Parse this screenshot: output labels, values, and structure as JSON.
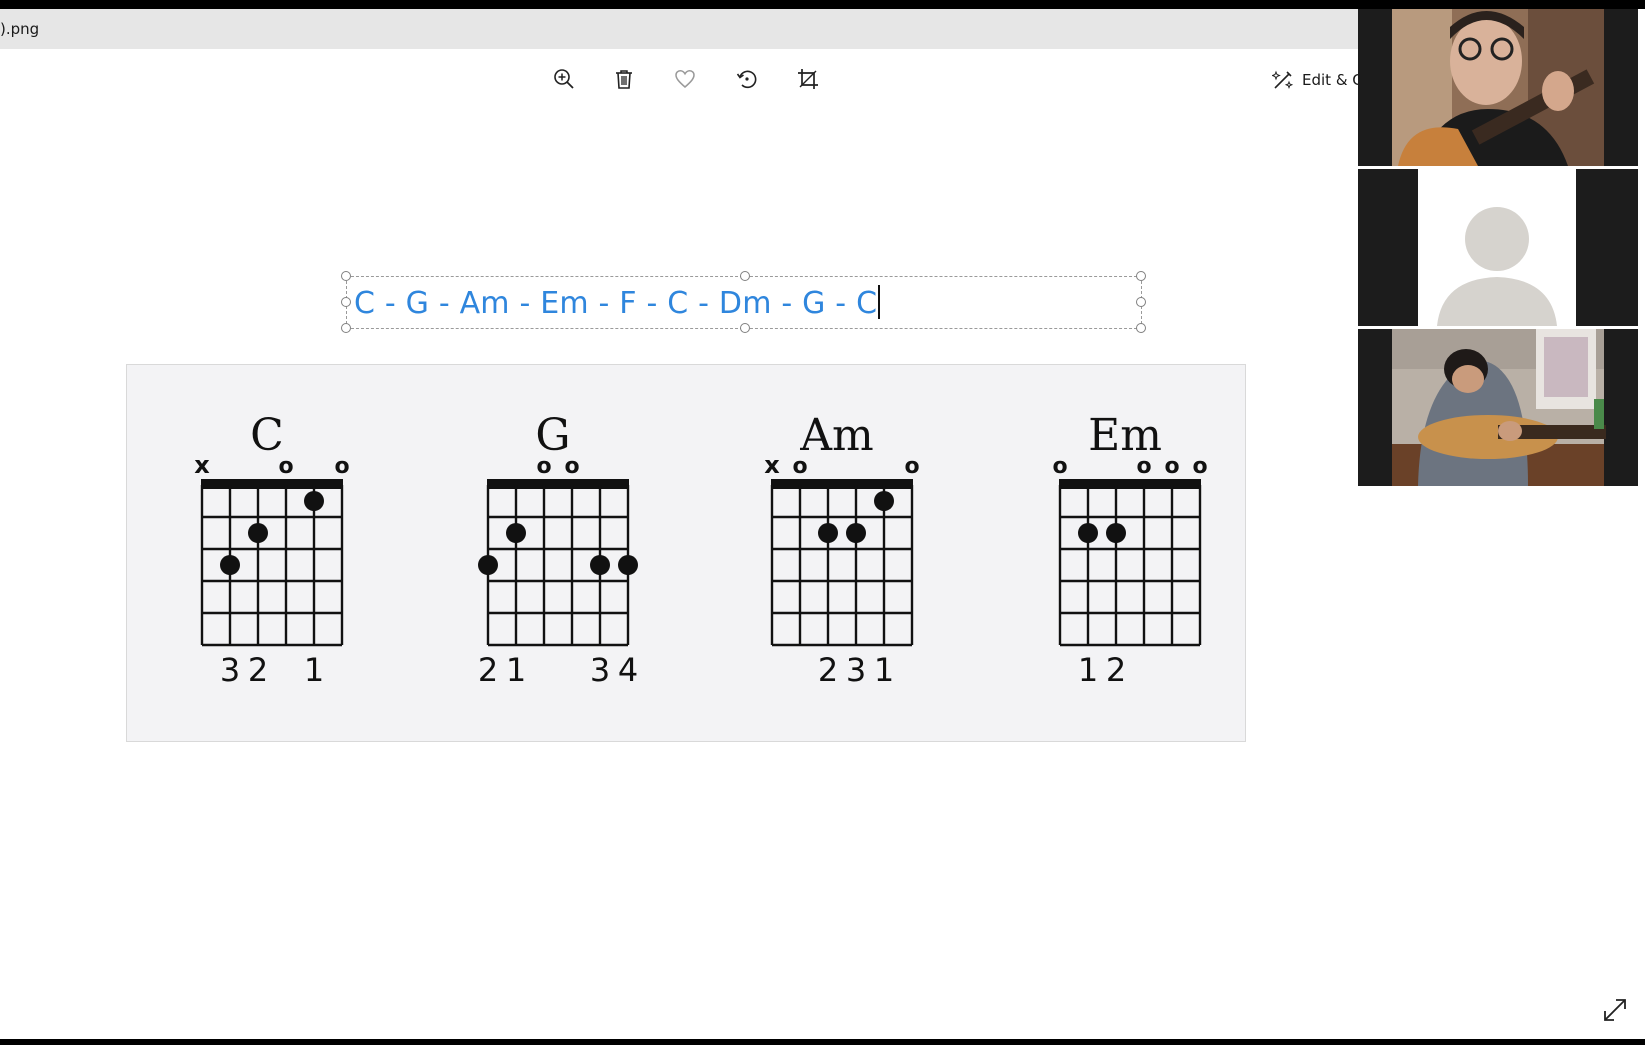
{
  "window": {
    "title": ").png"
  },
  "toolbar": {
    "buttons": [
      {
        "icon": "zoom-in-icon"
      },
      {
        "icon": "delete-icon"
      },
      {
        "icon": "heart-icon"
      },
      {
        "icon": "rotate-icon"
      },
      {
        "icon": "crop-icon"
      }
    ],
    "edit_create_label": "Edit & C"
  },
  "text_annotation": {
    "value": "C - G - Am - Em - F - C - Dm - G - C",
    "color": "#2f86dd"
  },
  "chord_chart": {
    "chords": [
      {
        "name": "C",
        "markers": [
          "x",
          "",
          "",
          "o",
          "",
          "o"
        ],
        "fingering": [
          "",
          "3",
          "2",
          "",
          "1",
          ""
        ],
        "dots": [
          {
            "string": 2,
            "fret": 3
          },
          {
            "string": 3,
            "fret": 2
          },
          {
            "string": 5,
            "fret": 1
          }
        ]
      },
      {
        "name": "G",
        "markers": [
          "",
          "",
          "o",
          "o",
          "",
          ""
        ],
        "fingering": [
          "2",
          "1",
          "",
          "",
          "3",
          "4"
        ],
        "dots": [
          {
            "string": 1,
            "fret": 3
          },
          {
            "string": 2,
            "fret": 2
          },
          {
            "string": 5,
            "fret": 3
          },
          {
            "string": 6,
            "fret": 3
          }
        ]
      },
      {
        "name": "Am",
        "markers": [
          "x",
          "o",
          "",
          "",
          "",
          "o"
        ],
        "fingering": [
          "",
          "",
          "2",
          "3",
          "1",
          ""
        ],
        "dots": [
          {
            "string": 3,
            "fret": 2
          },
          {
            "string": 4,
            "fret": 2
          },
          {
            "string": 5,
            "fret": 1
          }
        ]
      },
      {
        "name": "Em",
        "markers": [
          "o",
          "",
          "",
          "o",
          "o",
          "o"
        ],
        "fingering": [
          "",
          "1",
          "2",
          "",
          "",
          ""
        ],
        "dots": [
          {
            "string": 2,
            "fret": 2
          },
          {
            "string": 3,
            "fret": 2
          }
        ]
      }
    ]
  },
  "video_call": {
    "participants": [
      {
        "name": "participant-1",
        "state": "video"
      },
      {
        "name": "participant-2",
        "state": "avatar"
      },
      {
        "name": "participant-3",
        "state": "video"
      }
    ]
  },
  "footer": {
    "expand_icon": "expand-icon"
  }
}
